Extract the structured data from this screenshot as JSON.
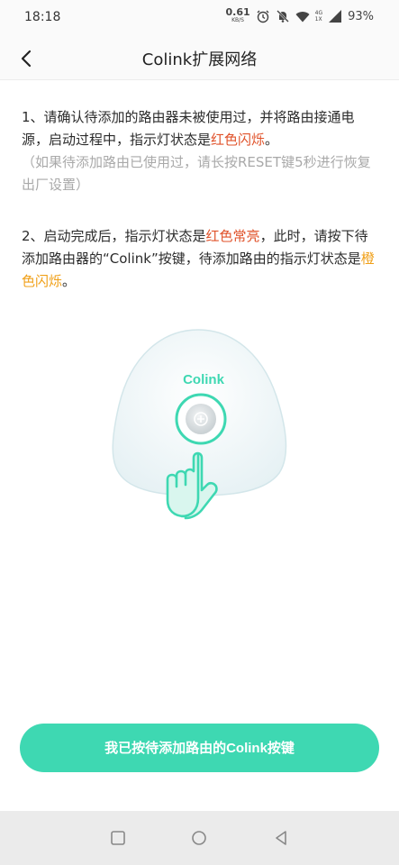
{
  "status_bar": {
    "time": "18:18",
    "net_speed_value": "0.61",
    "net_speed_unit": "KB/S",
    "signal_label_top": "4G",
    "signal_label_bottom": "1X",
    "battery": "93%"
  },
  "header": {
    "title": "Colink扩展网络"
  },
  "instructions": {
    "step1_text": "1、请确认待添加的路由器未被使用过，并将路由接通电源，启动过程中，指示灯状态是",
    "step1_highlight": "红色闪烁",
    "step1_end": "。",
    "step1_note": "（如果待添加路由已使用过，请长按RESET键5秒进行恢复出厂设置）",
    "step2_text_a": "2、启动完成后，指示灯状态是",
    "step2_highlight_a": "红色常亮",
    "step2_text_b": "，此时，请按下待添加路由器的“Colink”按键，待添加路由的指示灯状态是",
    "step2_highlight_b": "橙色闪烁",
    "step2_end": "。"
  },
  "illustration": {
    "device_label": "Colink"
  },
  "actions": {
    "confirm_label": "我已按待添加路由的Colink按键"
  },
  "colors": {
    "accent": "#3ed8b2",
    "warning_red": "#e0522a",
    "warning_orange": "#f0a019"
  },
  "icons": {
    "back": "chevron-left-icon",
    "alarm": "alarm-icon",
    "mute": "bell-off-icon",
    "wifi": "wifi-icon",
    "signal": "cellular-signal-icon",
    "nav_recent": "square-icon",
    "nav_home": "circle-icon",
    "nav_back": "triangle-back-icon"
  }
}
